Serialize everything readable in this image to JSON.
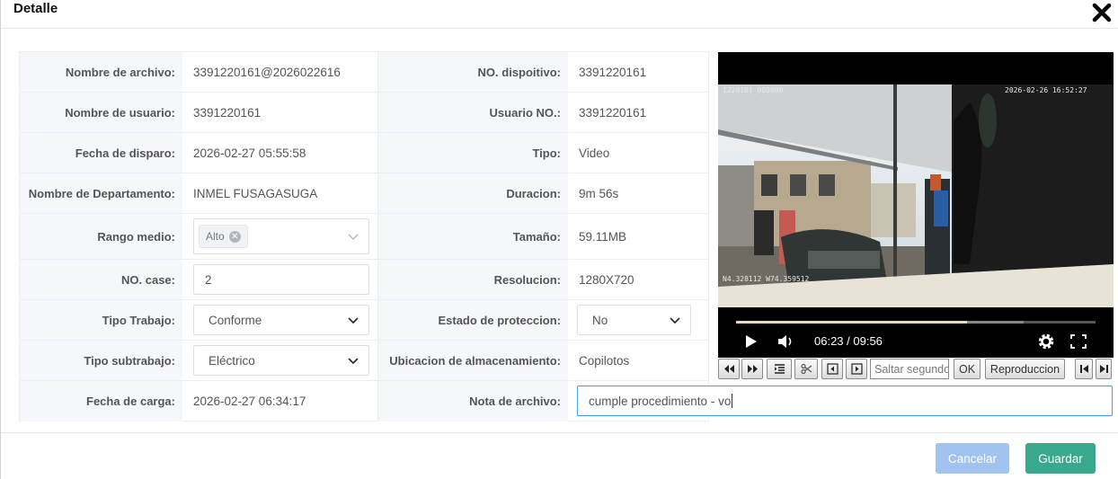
{
  "dialog": {
    "title": "Detalle",
    "buttons": {
      "cancel": "Cancelar",
      "save": "Guardar"
    }
  },
  "fields": {
    "nombre_archivo": {
      "label": "Nombre de archivo:",
      "value": "3391220161@2026022616"
    },
    "no_dispositivo": {
      "label": "NO. dispoitivo:",
      "value": "3391220161"
    },
    "nombre_usuario": {
      "label": "Nombre de usuario:",
      "value": "3391220161"
    },
    "usuario_no": {
      "label": "Usuario NO.:",
      "value": "3391220161"
    },
    "fecha_disparo": {
      "label": "Fecha de disparo:",
      "value": "2026-02-27 05:55:58"
    },
    "tipo": {
      "label": "Tipo:",
      "value": "Video"
    },
    "departamento": {
      "label": "Nombre de Departamento:",
      "value": "INMEL FUSAGASUGA"
    },
    "duracion": {
      "label": "Duracion:",
      "value": "9m 56s"
    },
    "rango_medio": {
      "label": "Rango medio:",
      "tag": "Alto"
    },
    "tamano": {
      "label": "Tamaño:",
      "value": "59.11MB"
    },
    "no_case": {
      "label": "NO. case:",
      "value": "2"
    },
    "resolucion": {
      "label": "Resolucion:",
      "value": "1280X720"
    },
    "tipo_trabajo": {
      "label": "Tipo Trabajo:",
      "value": "Conforme"
    },
    "estado_proteccion": {
      "label": "Estado de proteccion:",
      "value": "No"
    },
    "tipo_subtrabajo": {
      "label": "Tipo subtrabajo:",
      "value": "Eléctrico"
    },
    "ubicacion": {
      "label": "Ubicacion de almacenamiento:",
      "value": "Copilotos"
    },
    "fecha_carga": {
      "label": "Fecha de carga:",
      "value": "2026-02-27 06:34:17"
    },
    "nota_archivo": {
      "label": "Nota de archivo:",
      "value": "cumple procedimiento - vo"
    }
  },
  "video": {
    "osd_top_left": "1220161_000000",
    "osd_top_right": "2026-02-26 16:52:27",
    "osd_bottom_left": "N4.328112 W74.359512",
    "time": "06:23 / 09:56",
    "progress": 0.642,
    "buffered": 0.8
  },
  "player_toolbar": {
    "seek_placeholder": "Saltar segundos",
    "ok": "OK",
    "playback": "Reproduccion"
  },
  "colors": {
    "save": "#3aa88c",
    "cancel": "#a0c4ef",
    "focus": "#409eff"
  }
}
